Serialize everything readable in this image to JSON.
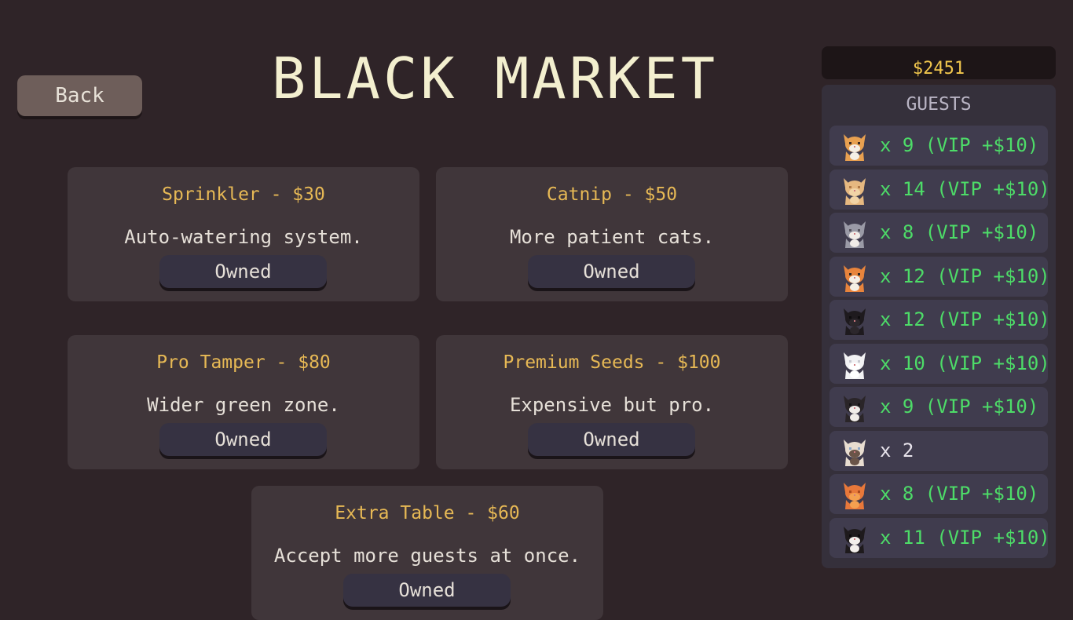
{
  "title": "BLACK MARKET",
  "back_label": "Back",
  "money": "$2451",
  "colors": {
    "background": "#2f2428",
    "card": "#40363a",
    "item_name": "#e7b955",
    "vip_text": "#4ddc68",
    "money": "#f2c74d"
  },
  "items": [
    {
      "name": "Sprinkler - $30",
      "desc": "Auto-watering system.",
      "button": "Owned"
    },
    {
      "name": "Catnip - $50",
      "desc": "More patient cats.",
      "button": "Owned"
    },
    {
      "name": "Pro Tamper - $80",
      "desc": "Wider green zone.",
      "button": "Owned"
    },
    {
      "name": "Premium Seeds - $100",
      "desc": "Expensive but pro.",
      "button": "Owned"
    },
    {
      "name": "Extra Table - $60",
      "desc": "Accept more guests at once.",
      "button": "Owned"
    }
  ],
  "guests": {
    "title": "GUESTS",
    "rows": [
      {
        "text": "x 9 (VIP +$10)",
        "vip": true,
        "cat": "calico-cat-icon"
      },
      {
        "text": "x 14 (VIP +$10)",
        "vip": true,
        "cat": "long-haired-cream-cat-icon"
      },
      {
        "text": "x 8 (VIP +$10)",
        "vip": true,
        "cat": "gray-tabby-cat-icon"
      },
      {
        "text": "x 12 (VIP +$10)",
        "vip": true,
        "cat": "orange-white-calico-cat-icon"
      },
      {
        "text": "x 12 (VIP +$10)",
        "vip": true,
        "cat": "black-longhair-cat-icon"
      },
      {
        "text": "x 10 (VIP +$10)",
        "vip": true,
        "cat": "white-persian-cat-icon"
      },
      {
        "text": "x 9 (VIP +$10)",
        "vip": true,
        "cat": "tuxedo-longhair-cat-icon"
      },
      {
        "text": "x 2",
        "vip": false,
        "cat": "siamese-cat-icon"
      },
      {
        "text": "x 8 (VIP +$10)",
        "vip": true,
        "cat": "orange-tabby-cat-icon"
      },
      {
        "text": "x 11 (VIP +$10)",
        "vip": true,
        "cat": "tuxedo-cat-icon"
      }
    ]
  }
}
